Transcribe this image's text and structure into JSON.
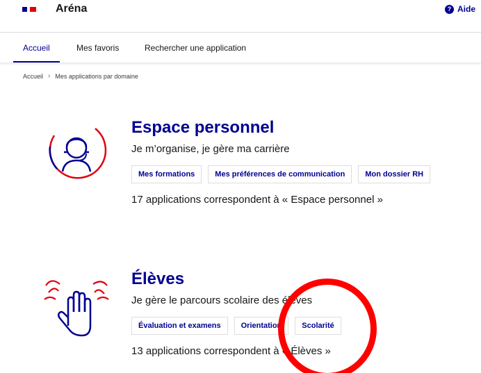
{
  "header": {
    "app_title": "Aréna",
    "help_label": "Aide",
    "help_icon_glyph": "?"
  },
  "nav": {
    "items": [
      {
        "label": "Accueil",
        "active": true
      },
      {
        "label": "Mes favoris",
        "active": false
      },
      {
        "label": "Rechercher une application",
        "active": false
      }
    ]
  },
  "breadcrumb": {
    "items": [
      "Accueil",
      "Mes applications par domaine"
    ],
    "separator": "›"
  },
  "domains": [
    {
      "title": "Espace personnel",
      "subtitle": "Je m’organise, je gère ma carrière",
      "tags": [
        "Mes formations",
        "Mes préférences de communication",
        "Mon dossier RH"
      ],
      "count_text": "17 applications correspondent à « Espace personnel »"
    },
    {
      "title": "Élèves",
      "subtitle": "Je gère le parcours scolaire des élèves",
      "tags": [
        "Évaluation et examens",
        "Orientation",
        "Scolarité"
      ],
      "count_text": "13 applications correspondent à « Élèves »"
    }
  ],
  "colors": {
    "primary_blue": "#000091",
    "flag_red": "#e1000f",
    "annotation_red": "#ff0000"
  }
}
